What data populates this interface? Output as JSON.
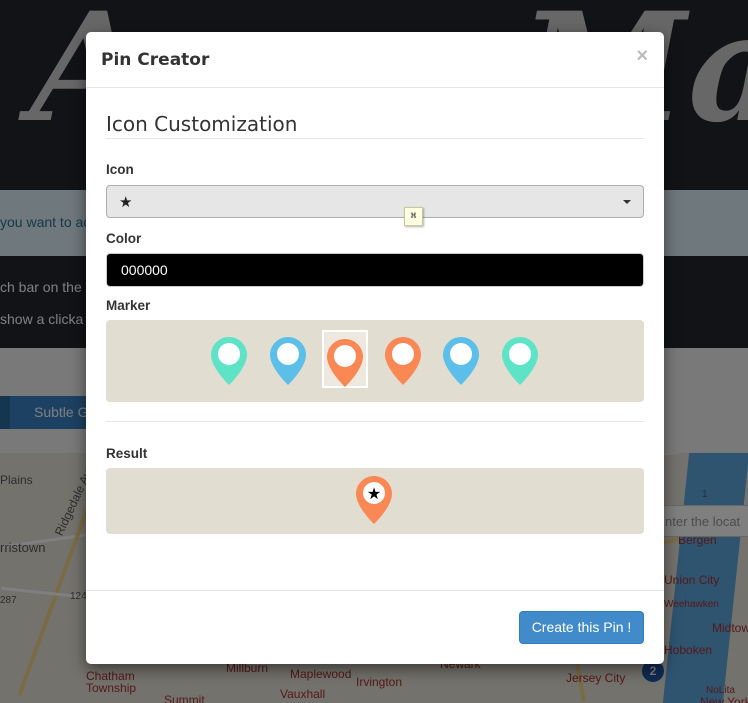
{
  "background": {
    "title_left": "A",
    "title_right": "Map",
    "info_text": "you want to ac",
    "dark_line1": "ch bar on the r",
    "dark_line2": " show a clicka",
    "tab_label": "Subtle Gr",
    "search_placeholder": "nter the locat",
    "map_labels": [
      {
        "text": "Plains",
        "red": false
      },
      {
        "text": "Ridgedale Ave",
        "red": false
      },
      {
        "text": "rristown",
        "red": false
      },
      {
        "text": "Millburn",
        "red": true
      },
      {
        "text": "Maplewood",
        "red": true
      },
      {
        "text": "Chatham",
        "red": true
      },
      {
        "text": "Township",
        "red": true
      },
      {
        "text": "Vauxhall",
        "red": true
      },
      {
        "text": "Summit",
        "red": true
      },
      {
        "text": "Irvington",
        "red": true
      },
      {
        "text": "Newark",
        "red": true
      },
      {
        "text": "Jersey City",
        "red": true
      },
      {
        "text": "Union City",
        "red": true
      },
      {
        "text": "Bergen",
        "red": true
      },
      {
        "text": "Weehawken",
        "red": true
      },
      {
        "text": "Hoboken",
        "red": true
      },
      {
        "text": "Midtow",
        "red": true
      },
      {
        "text": "NoLita",
        "red": true
      },
      {
        "text": "New York",
        "red": true
      },
      {
        "text": "287",
        "red": false
      },
      {
        "text": "124",
        "red": false
      },
      {
        "text": "1",
        "red": false
      },
      {
        "text": "2",
        "red": false
      }
    ]
  },
  "modal": {
    "title": "Pin Creator",
    "close_label": "×",
    "section_title": "Icon Customization",
    "icon_label": "Icon",
    "icon_value": "★",
    "color_label": "Color",
    "color_value": "000000",
    "marker_label": "Marker",
    "markers": [
      {
        "color": "#5fe3c7",
        "selected": false
      },
      {
        "color": "#5bbfea",
        "selected": false
      },
      {
        "color": "#fa8855",
        "selected": true
      },
      {
        "color": "#fa8855",
        "selected": false
      },
      {
        "color": "#5bbfea",
        "selected": false
      },
      {
        "color": "#5fe3c7",
        "selected": false
      }
    ],
    "result_label": "Result",
    "result_pin_color": "#fa8855",
    "result_icon": "★",
    "create_button": "Create this Pin !"
  },
  "tooltip_glyph": "⌘"
}
